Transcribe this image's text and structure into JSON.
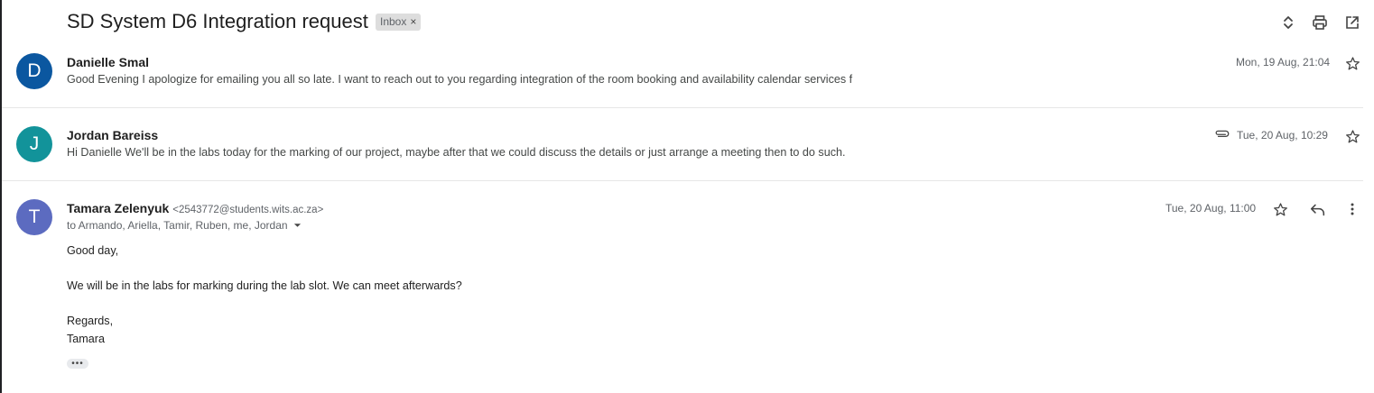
{
  "thread": {
    "subject": "SD System D6 Integration request",
    "label_badge": "Inbox",
    "label_remove": "×",
    "top_icons": [
      "expand-collapse-icon",
      "print-icon",
      "open-in-new-window-icon"
    ]
  },
  "messages": [
    {
      "avatar_letter": "D",
      "avatar_color": "#0b57a0",
      "sender": "Danielle Smal",
      "date": "Mon, 19 Aug, 21:04",
      "snippet": "Good Evening I apologize for emailing you all so late. I want to reach out to you regarding integration of the room booking and availability calendar services f"
    },
    {
      "avatar_letter": "J",
      "avatar_color": "#12939a",
      "sender": "Jordan Bareiss",
      "date": "Tue, 20 Aug, 10:29",
      "has_attachment": true,
      "snippet": "Hi Danielle We'll be in the labs today for the marking of our project, maybe after that we could discuss the details or just arrange a meeting then to do such."
    },
    {
      "avatar_letter": "T",
      "avatar_color": "#5c6bc0",
      "sender": "Tamara Zelenyuk",
      "email": "<2543772@students.wits.ac.za>",
      "date": "Tue, 20 Aug, 11:00",
      "recipients": "to Armando, Ariella, Tamir, Ruben, me, Jordan",
      "body": [
        "Good day,",
        "We will be in the labs for marking during the lab slot. We can meet afterwards?",
        "Regards,",
        "Tamara"
      ],
      "trimmed_content": "•••"
    }
  ]
}
